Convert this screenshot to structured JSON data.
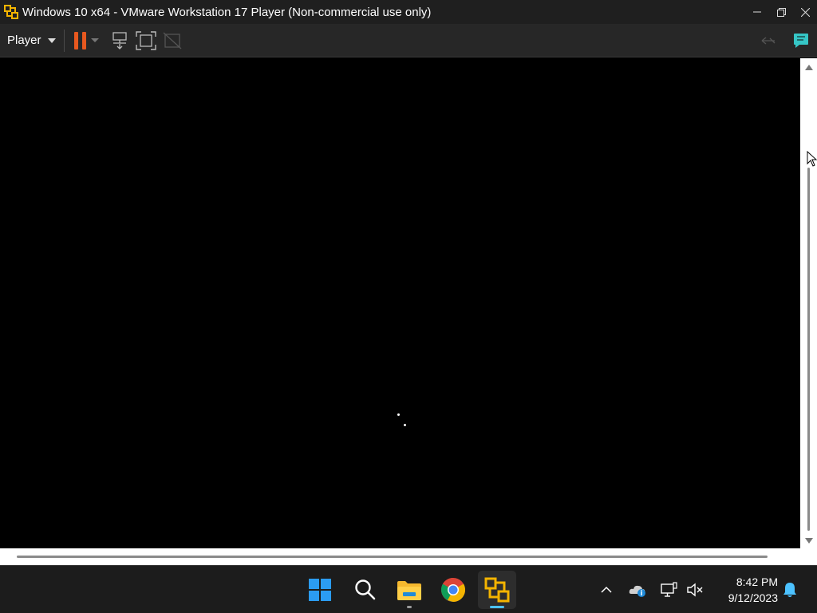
{
  "window": {
    "title": "Windows 10 x64 - VMware Workstation 17 Player (Non-commercial use only)",
    "app_icon": "vmware-icon",
    "controls": [
      "minimize",
      "restore",
      "close"
    ]
  },
  "toolbar": {
    "player_menu_label": "Player",
    "buttons": [
      "pause-icon",
      "send-ctrl-alt-del-icon",
      "full-screen-icon",
      "unity-icon"
    ],
    "right_buttons": [
      "send-feedback-icon",
      "message-log-icon"
    ]
  },
  "vm_screen": {
    "background": "#000000",
    "loading_indicator": "spinning-dots"
  },
  "taskbar": {
    "apps": [
      "windows-start-icon",
      "search-icon",
      "file-explorer-icon",
      "chrome-icon",
      "vmware-player-icon"
    ],
    "tray_icons": [
      "show-hidden-icons-chevron",
      "onedrive-icon",
      "network-icon",
      "volume-muted-icon"
    ],
    "clock": {
      "time": "8:42 PM",
      "date": "9/12/2023"
    },
    "notification_icon": "bell-icon"
  },
  "colors": {
    "titlebar_bg": "#1f1f1f",
    "toolbar_bg": "#272727",
    "pause_accent": "#e8581f",
    "taskbar_bg": "#1c1c1c",
    "active_indicator": "#4cc2ff"
  }
}
